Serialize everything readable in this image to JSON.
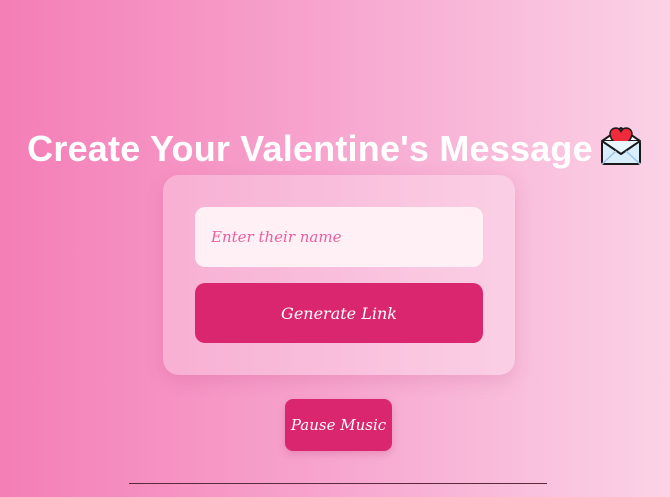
{
  "header": {
    "title": "Create Your Valentine's Message",
    "title_icon": "love-letter-icon"
  },
  "form": {
    "name_placeholder": "Enter their name",
    "name_value": "",
    "generate_label": "Generate Link"
  },
  "music": {
    "toggle_label": "Pause Music"
  },
  "colors": {
    "background_start": "#f47eb6",
    "background_end": "#fbd2e6",
    "accent": "#d9266f",
    "input_background": "#fff0f6",
    "placeholder_text": "#e8609f"
  }
}
